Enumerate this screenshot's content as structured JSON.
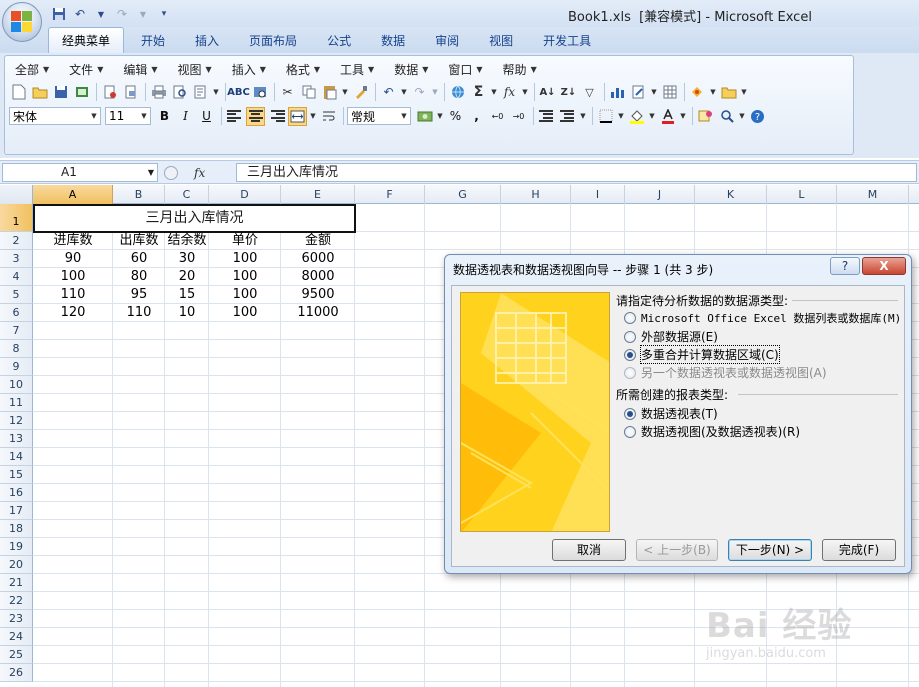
{
  "window": {
    "title": "Book1.xls  [兼容模式] - Microsoft Excel"
  },
  "tabs": [
    "经典菜单",
    "开始",
    "插入",
    "页面布局",
    "公式",
    "数据",
    "审阅",
    "视图",
    "开发工具"
  ],
  "active_tab": "经典菜单",
  "menus": [
    "全部",
    "文件",
    "编辑",
    "视图",
    "插入",
    "格式",
    "工具",
    "数据",
    "窗口",
    "帮助"
  ],
  "format": {
    "font": "宋体",
    "size": "11",
    "number_format": "常规",
    "bold": "B",
    "italic": "I",
    "underline": "U",
    "percent": "%",
    "comma": ","
  },
  "formula_bar": {
    "name_box": "A1",
    "fx": "fx",
    "content": "三月出入库情况"
  },
  "columns": [
    "A",
    "B",
    "C",
    "D",
    "E",
    "F",
    "G",
    "H",
    "I",
    "J",
    "K",
    "L",
    "M"
  ],
  "rows": [
    "1",
    "2",
    "3",
    "4",
    "5",
    "6",
    "7",
    "8",
    "9",
    "10",
    "11",
    "12",
    "13",
    "14",
    "15",
    "16",
    "17",
    "18",
    "19",
    "20",
    "21",
    "22",
    "23",
    "24",
    "25",
    "26"
  ],
  "sheet": {
    "title": "三月出入库情况",
    "headers": [
      "进库数",
      "出库数",
      "结余数",
      "单价",
      "金额"
    ],
    "data": [
      [
        "90",
        "60",
        "30",
        "100",
        "6000"
      ],
      [
        "100",
        "80",
        "20",
        "100",
        "8000"
      ],
      [
        "110",
        "95",
        "15",
        "100",
        "9500"
      ],
      [
        "120",
        "110",
        "10",
        "100",
        "11000"
      ]
    ]
  },
  "dialog": {
    "title": "数据透视表和数据透视图向导 -- 步骤 1 (共 3 步)",
    "help": "?",
    "close": "X",
    "source_label": "请指定待分析数据的数据源类型:",
    "source_options": [
      {
        "label": "Microsoft Office Excel 数据列表或数据库(M)",
        "checked": false,
        "disabled": false
      },
      {
        "label": "外部数据源(E)",
        "checked": false,
        "disabled": false
      },
      {
        "label": "多重合并计算数据区域(C)",
        "checked": true,
        "disabled": false
      },
      {
        "label": "另一个数据透视表或数据透视图(A)",
        "checked": false,
        "disabled": true
      }
    ],
    "report_label": "所需创建的报表类型:",
    "report_options": [
      {
        "label": "数据透视表(T)",
        "checked": true
      },
      {
        "label": "数据透视图(及数据透视表)(R)",
        "checked": false
      }
    ],
    "buttons": {
      "cancel": "取消",
      "back": "< 上一步(B)",
      "next": "下一步(N) >",
      "finish": "完成(F)"
    }
  },
  "watermark": {
    "brand": "Bai 经验",
    "url": "jingyan.baidu.com"
  },
  "colors": {
    "accent": "#f1c15f",
    "ribbon": "#dfe9f6",
    "title_bar": "#d3e1f3"
  }
}
